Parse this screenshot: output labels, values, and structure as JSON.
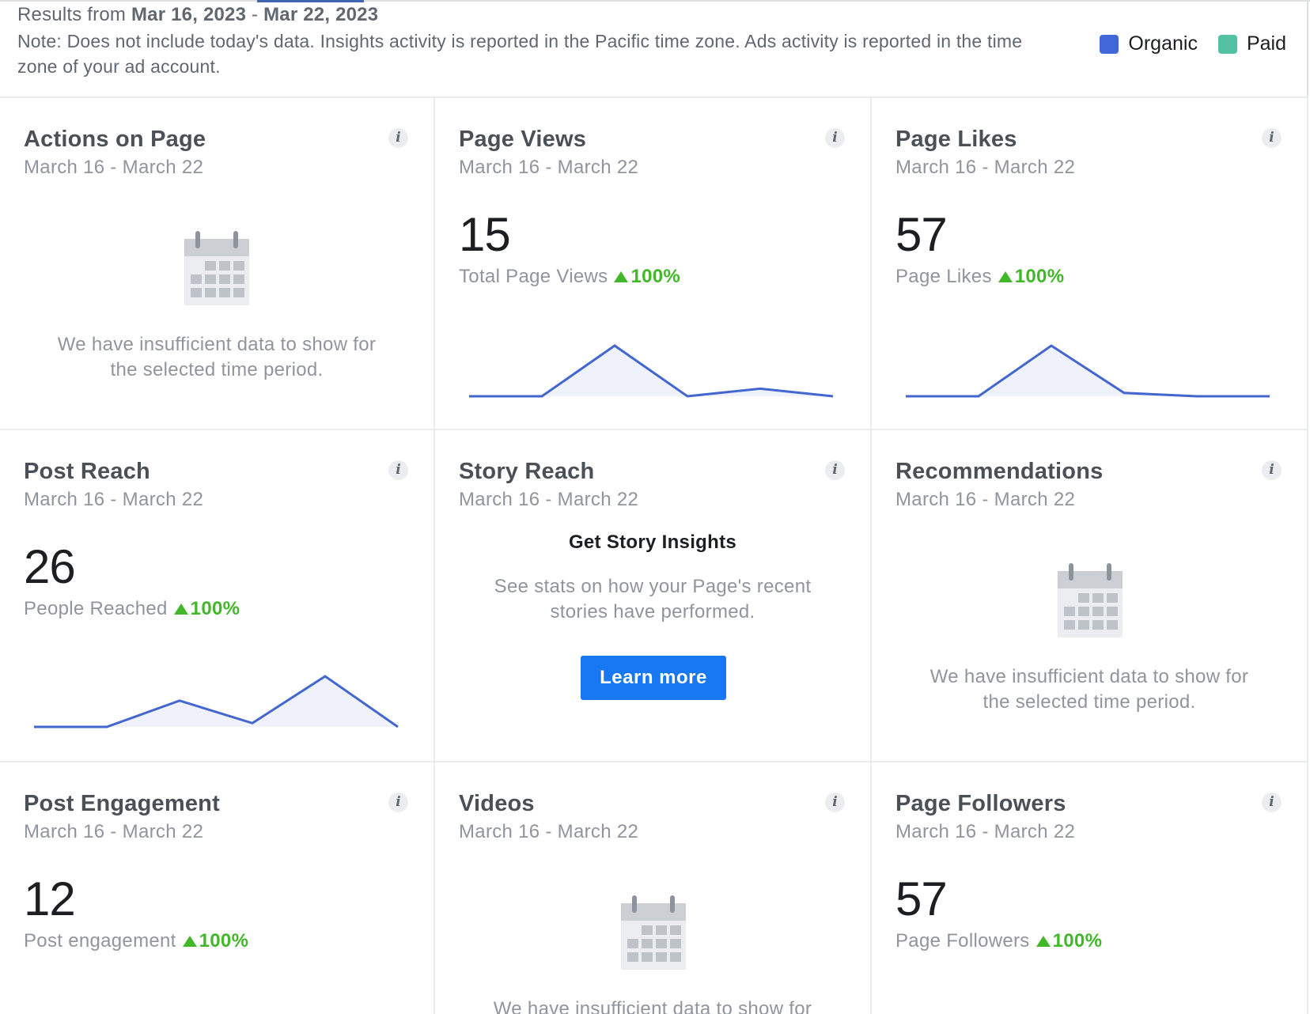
{
  "header": {
    "results_prefix": "Results from",
    "date_start": "Mar 16, 2023",
    "date_sep": "-",
    "date_end": "Mar 22, 2023",
    "note": "Note: Does not include today's data. Insights activity is reported in the Pacific time zone. Ads activity is reported in the time zone of your ad account.",
    "legend": [
      {
        "label": "Organic",
        "color": "#4267d9"
      },
      {
        "label": "Paid",
        "color": "#55c1a4"
      }
    ]
  },
  "colors": {
    "line": "#4366cf",
    "area": "#eff1fb",
    "up": "#42b72a",
    "button": "#1877f2"
  },
  "insufficient_text_1": "We have insufficient data to show for",
  "insufficient_text_2": "the selected time period.",
  "cards": {
    "actions": {
      "title": "Actions on Page",
      "date": "March 16 - March 22"
    },
    "views": {
      "title": "Page Views",
      "date": "March 16 - March 22",
      "value": "15",
      "label": "Total Page Views",
      "change": "100%",
      "trend": [
        0,
        0,
        4,
        0,
        0.6,
        0
      ]
    },
    "likes": {
      "title": "Page Likes",
      "date": "March 16 - March 22",
      "value": "57",
      "label": "Page Likes",
      "change": "100%",
      "trend": [
        0,
        0,
        3,
        0.2,
        0,
        0
      ]
    },
    "reach": {
      "title": "Post Reach",
      "date": "March 16 - March 22",
      "value": "26",
      "label": "People Reached",
      "change": "100%",
      "trend": [
        0,
        0,
        1.4,
        0.2,
        2.7,
        0
      ]
    },
    "story": {
      "title": "Story Reach",
      "date": "March 16 - March 22",
      "heading": "Get Story Insights",
      "text1": "See stats on how your Page's recent",
      "text2": "stories have performed.",
      "button": "Learn more"
    },
    "recs": {
      "title": "Recommendations",
      "date": "March 16 - March 22"
    },
    "engagement": {
      "title": "Post Engagement",
      "date": "March 16 - March 22",
      "value": "12",
      "label": "Post engagement",
      "change": "100%"
    },
    "videos": {
      "title": "Videos",
      "date": "March 16 - March 22"
    },
    "followers": {
      "title": "Page Followers",
      "date": "March 16 - March 22",
      "value": "57",
      "label": "Page Followers",
      "change": "100%"
    }
  }
}
